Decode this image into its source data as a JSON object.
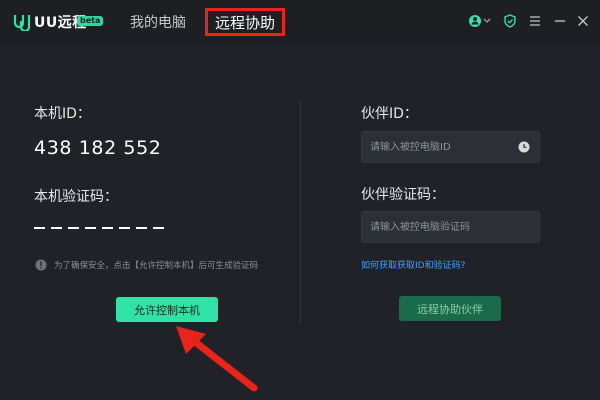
{
  "header": {
    "app_name": "UU远程",
    "beta_badge": "beta",
    "tabs": [
      {
        "label": "我的电脑"
      },
      {
        "label": "远程协助"
      }
    ],
    "icons": [
      "user-icon",
      "chevron-down-icon",
      "shield-icon",
      "menu-icon",
      "minimize-icon",
      "close-icon"
    ]
  },
  "left_panel": {
    "id_label": "本机ID：",
    "id_value": "438 182 552",
    "code_label": "本机验证码：",
    "hint": "为了确保安全，点击【允许控制本机】后可生成验证码",
    "allow_button": "允许控制本机"
  },
  "right_panel": {
    "partner_id_label": "伙伴ID：",
    "partner_id_placeholder": "请输入被控电脑ID",
    "partner_code_label": "伙伴验证码：",
    "partner_code_placeholder": "请输入被控电脑验证码",
    "help_link": "如何获取获取ID和验证码?",
    "remote_button": "远程协助伙伴"
  },
  "colors": {
    "background": "#202227",
    "accent": "#2fe3a6",
    "accent_dark": "#1a6b4b",
    "link": "#3ba3ff",
    "annotation": "#e8241b"
  }
}
